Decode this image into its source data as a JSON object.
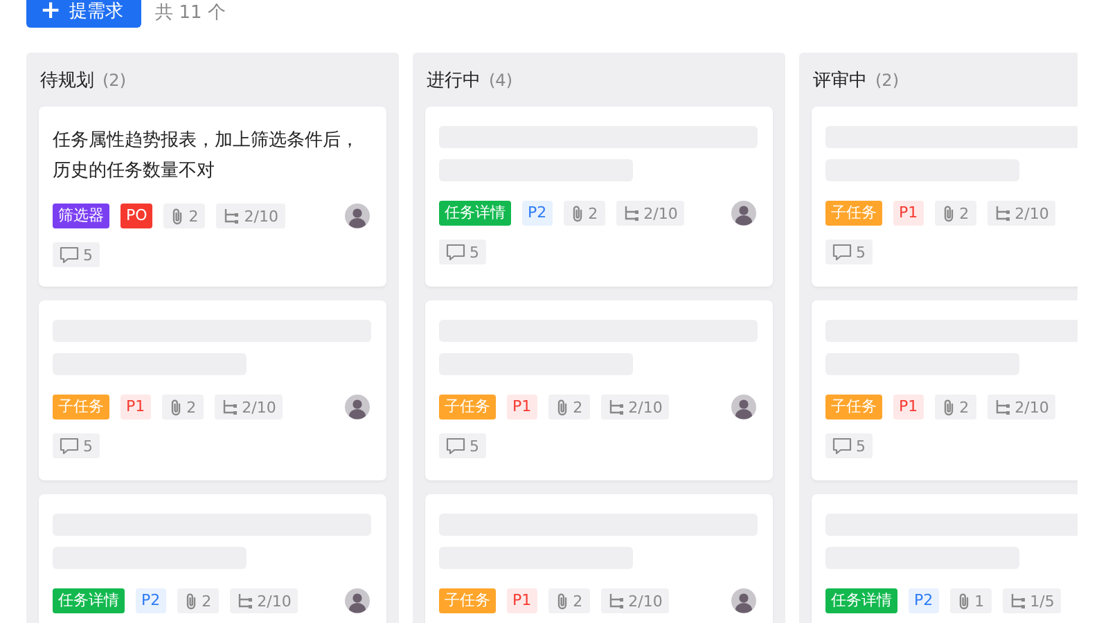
{
  "toolbar": {
    "add_button": {
      "icon": "+",
      "label": "提需求"
    },
    "total": "共 11 个"
  },
  "columns": [
    {
      "title": "待规划",
      "count": "(2)",
      "cards": [
        {
          "kind": "text",
          "title": "任务属性趋势报表，加上筛选条件后，历史的任务数量不对",
          "tags": [
            {
              "label": "筛选器",
              "color": "#7b3ff2",
              "kind": "solid"
            },
            {
              "label": "PO",
              "color": "#f5392f",
              "kind": "solid"
            }
          ],
          "attachments": "2",
          "subtasks": "2/10",
          "avatar": true,
          "comments": "5"
        },
        {
          "kind": "skeleton",
          "tags": [
            {
              "label": "子任务",
              "color": "#ffa52b",
              "kind": "solid"
            },
            {
              "label": "P1",
              "color": "#f5392f",
              "kind": "light"
            }
          ],
          "attachments": "2",
          "subtasks": "2/10",
          "avatar": true,
          "comments": "5"
        },
        {
          "kind": "skeleton",
          "tags": [
            {
              "label": "任务详情",
              "color": "#13b94f",
              "kind": "solid"
            },
            {
              "label": "P2",
              "color": "#2c7bf5",
              "kind": "light"
            }
          ],
          "attachments": "2",
          "subtasks": "2/10",
          "avatar": true
        }
      ]
    },
    {
      "title": "进行中",
      "count": "(4)",
      "cards": [
        {
          "kind": "skeleton",
          "tags": [
            {
              "label": "任务详情",
              "color": "#13b94f",
              "kind": "solid"
            },
            {
              "label": "P2",
              "color": "#2c7bf5",
              "kind": "light"
            }
          ],
          "attachments": "2",
          "subtasks": "2/10",
          "avatar": true,
          "comments": "5"
        },
        {
          "kind": "skeleton",
          "tags": [
            {
              "label": "子任务",
              "color": "#ffa52b",
              "kind": "solid"
            },
            {
              "label": "P1",
              "color": "#f5392f",
              "kind": "light"
            }
          ],
          "attachments": "2",
          "subtasks": "2/10",
          "avatar": true,
          "comments": "5"
        },
        {
          "kind": "skeleton",
          "tags": [
            {
              "label": "子任务",
              "color": "#ffa52b",
              "kind": "solid"
            },
            {
              "label": "P1",
              "color": "#f5392f",
              "kind": "light"
            }
          ],
          "attachments": "2",
          "subtasks": "2/10",
          "avatar": true
        }
      ]
    },
    {
      "title": "评审中",
      "count": "(2)",
      "cards": [
        {
          "kind": "skeleton",
          "tags": [
            {
              "label": "子任务",
              "color": "#ffa52b",
              "kind": "solid"
            },
            {
              "label": "P1",
              "color": "#f5392f",
              "kind": "light"
            }
          ],
          "attachments": "2",
          "subtasks": "2/10",
          "comments": "5"
        },
        {
          "kind": "skeleton",
          "tags": [
            {
              "label": "子任务",
              "color": "#ffa52b",
              "kind": "solid"
            },
            {
              "label": "P1",
              "color": "#f5392f",
              "kind": "light"
            }
          ],
          "attachments": "2",
          "subtasks": "2/10",
          "comments": "5"
        },
        {
          "kind": "skeleton",
          "tags": [
            {
              "label": "任务详情",
              "color": "#13b94f",
              "kind": "solid"
            },
            {
              "label": "P2",
              "color": "#2c7bf5",
              "kind": "light"
            }
          ],
          "attachments": "1",
          "subtasks": "1/5"
        }
      ]
    }
  ]
}
